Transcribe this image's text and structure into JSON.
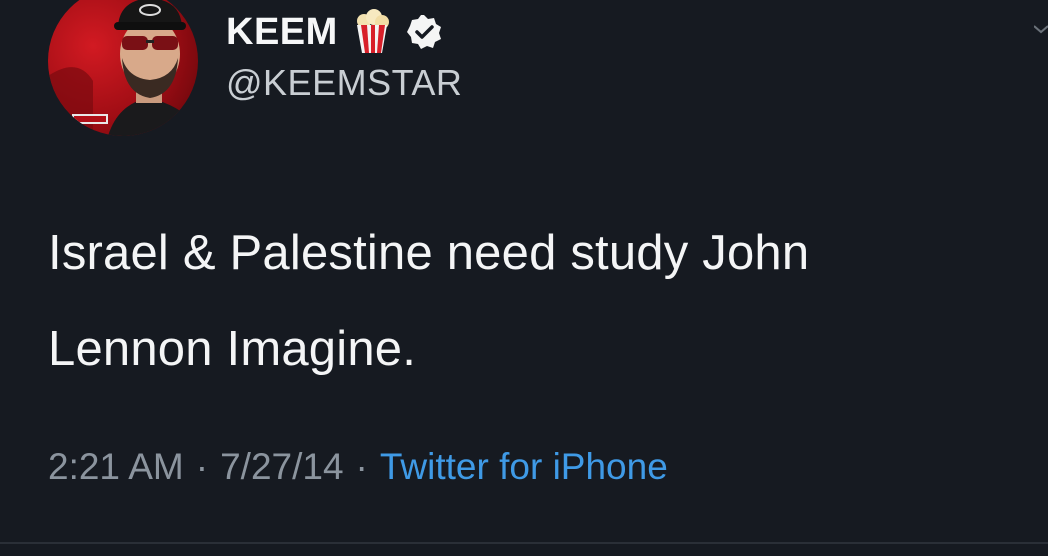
{
  "tweet": {
    "display_name": "KEEM",
    "handle": "@KEEMSTAR",
    "text": "Israel & Palestine need study John\nLennon Imagine.",
    "time": "2:21 AM",
    "date": "7/27/14",
    "source": "Twitter for iPhone",
    "separator": "·"
  },
  "icons": {
    "popcorn": "popcorn-icon",
    "verified": "verified-badge-icon",
    "caret": "chevron-down-icon"
  },
  "colors": {
    "background": "#161a21",
    "link": "#3f9ae6",
    "muted": "#8b949e",
    "avatar_bg": "#c8141c"
  }
}
